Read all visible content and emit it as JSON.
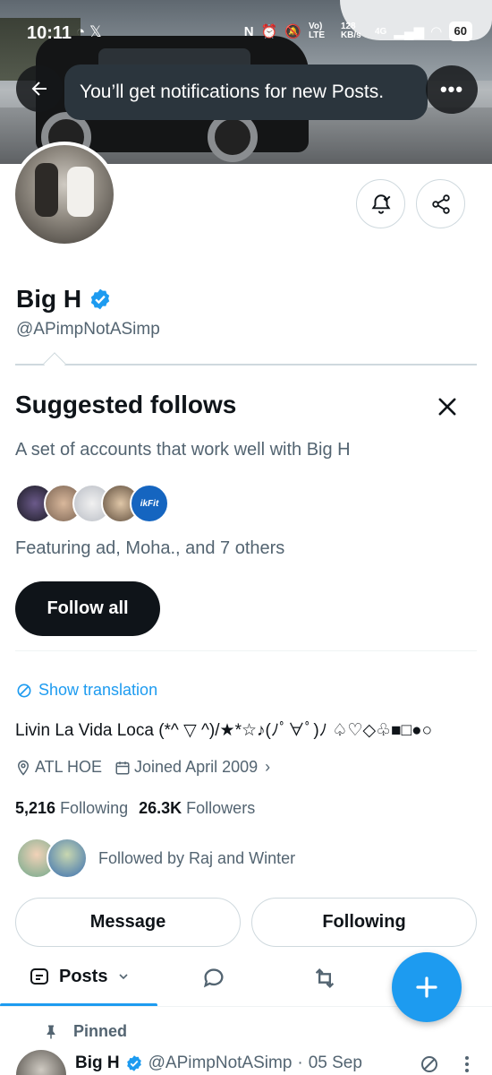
{
  "status_bar": {
    "time": "10:11",
    "network_label": "Vo) LTE",
    "speed": "128 KB/s",
    "network_type": "4G",
    "battery": "60"
  },
  "toast": {
    "message": "You’ll get notifications for new Posts."
  },
  "profile": {
    "name": "Big H",
    "handle": "@APimpNotASimp",
    "bio": "Livin La Vida Loca (*^ ▽ ^)/★*☆♪(ﾉﾟ∀ﾟ)ﾉ ♤♡◇♧■□●○",
    "location": "ATL HOE",
    "joined": "Joined April 2009",
    "following_count": "5,216",
    "following_label": "Following",
    "followers_count": "26.3K",
    "followers_label": "Followers",
    "followed_by": "Followed by Raj and Winter"
  },
  "suggested": {
    "title": "Suggested follows",
    "subtitle": "A set of accounts that work well with Big H",
    "featuring": "Featuring ad, Moha., and 7 others",
    "follow_all": "Follow all",
    "face_badge": "ikFit"
  },
  "translation": {
    "label": "Show translation"
  },
  "actions": {
    "message": "Message",
    "following": "Following"
  },
  "tabs": {
    "posts": "Posts"
  },
  "pinned_post": {
    "label": "Pinned",
    "author": "Big H",
    "handle": "@APimpNotASimp",
    "separator": "·",
    "date": "05 Sep"
  },
  "colors": {
    "accent": "#1d9bf0",
    "text": "#0f1419",
    "muted": "#536471"
  }
}
